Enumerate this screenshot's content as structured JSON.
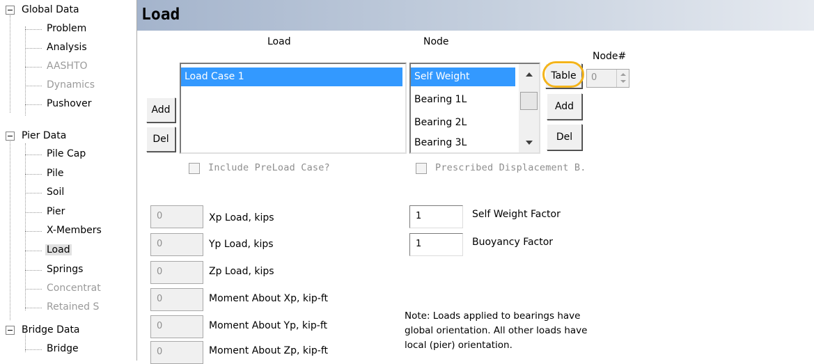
{
  "sidebar": {
    "tree": [
      {
        "label": "Global Data",
        "level": 0,
        "expander": true
      },
      {
        "label": "Problem",
        "level": 1
      },
      {
        "label": "Analysis",
        "level": 1
      },
      {
        "label": "AASHTO",
        "level": 1,
        "disabled": true
      },
      {
        "label": "Dynamics",
        "level": 1,
        "disabled": true
      },
      {
        "label": "Pushover",
        "level": 1
      },
      {
        "label": "Pier Data",
        "level": 0,
        "expander": true
      },
      {
        "label": "Pile Cap",
        "level": 1
      },
      {
        "label": "Pile",
        "level": 1
      },
      {
        "label": "Soil",
        "level": 1
      },
      {
        "label": "Pier",
        "level": 1
      },
      {
        "label": "X-Members",
        "level": 1
      },
      {
        "label": "Load",
        "level": 1,
        "selected": true
      },
      {
        "label": "Springs",
        "level": 1
      },
      {
        "label": "Concentrat",
        "level": 1,
        "disabled": true
      },
      {
        "label": "Retained S",
        "level": 1,
        "disabled": true
      },
      {
        "label": "Bridge Data",
        "level": 0,
        "expander": true
      },
      {
        "label": "Bridge",
        "level": 1
      }
    ]
  },
  "main": {
    "title": "Load",
    "load_column_label": "Load",
    "node_column_label": "Node",
    "node_number_label": "Node#",
    "load_list": [
      "Load Case 1"
    ],
    "node_list": [
      "Self Weight",
      "Bearing 1L",
      "Bearing 2L",
      "Bearing 3L"
    ],
    "load_add_label": "Add",
    "load_del_label": "Del",
    "table_label": "Table",
    "node_add_label": "Add",
    "node_del_label": "Del",
    "node_number_value": "0",
    "include_preload_label": "Include PreLoad Case?",
    "prescribed_disp_label": "Prescribed Displacement B.",
    "loads": [
      {
        "label": "Xp Load, kips",
        "value": "0"
      },
      {
        "label": "Yp Load, kips",
        "value": "0"
      },
      {
        "label": "Zp Load, kips",
        "value": "0"
      },
      {
        "label": "Moment About Xp, kip-ft",
        "value": "0"
      },
      {
        "label": "Moment About Yp, kip-ft",
        "value": "0"
      },
      {
        "label": "Moment About Zp, kip-ft",
        "value": "0"
      }
    ],
    "self_weight_factor": {
      "label": "Self Weight Factor",
      "value": "1"
    },
    "buoyancy_factor": {
      "label": "Buoyancy Factor",
      "value": "1"
    },
    "note_line1": "Note: Loads applied to bearings have",
    "note_line2": "global orientation.  All other loads have",
    "note_line3": "local (pier) orientation."
  },
  "colors": {
    "selection": "#3399ff",
    "highlight_ring": "#f4b41a",
    "header_gradient_start": "#a4b4cc"
  }
}
